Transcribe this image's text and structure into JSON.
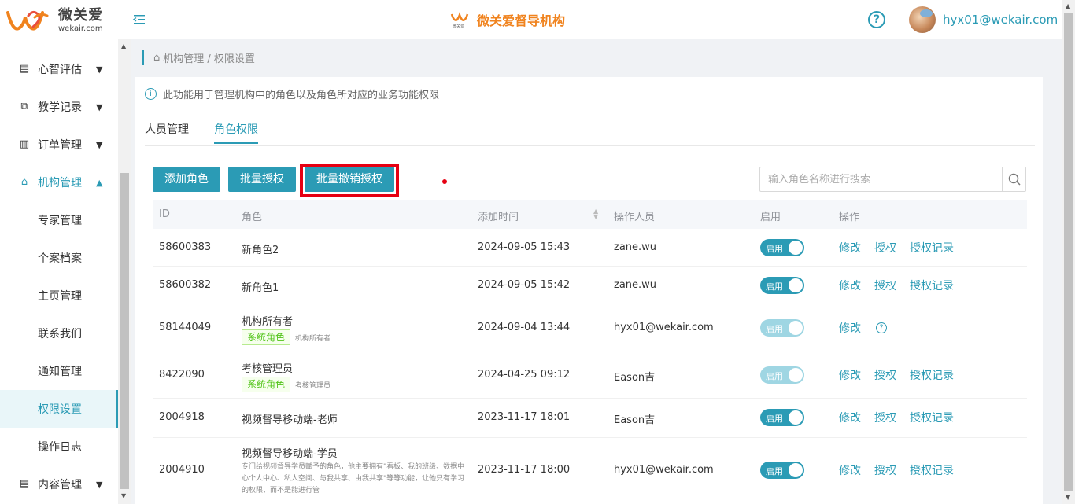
{
  "header": {
    "logo_cn": "微关爱",
    "logo_en": "wekair.com",
    "center_logo_text": "微关爱",
    "title": "微关爱督导机构",
    "help": "?",
    "user_email": "hyx01@wekair.com"
  },
  "sidebar": {
    "items": [
      {
        "label": "心智评估",
        "icon": "report-icon"
      },
      {
        "label": "教学记录",
        "icon": "video-icon"
      },
      {
        "label": "订单管理",
        "icon": "order-icon"
      },
      {
        "label": "机构管理",
        "icon": "bank-icon"
      },
      {
        "label": "专家管理"
      },
      {
        "label": "个案档案"
      },
      {
        "label": "主页管理"
      },
      {
        "label": "联系我们"
      },
      {
        "label": "通知管理"
      },
      {
        "label": "权限设置"
      },
      {
        "label": "操作日志"
      },
      {
        "label": "内容管理",
        "icon": "content-icon"
      }
    ]
  },
  "breadcrumb": "机构管理 / 权限设置",
  "notice": "此功能用于管理机构中的角色以及角色所对应的业务功能权限",
  "tabs": [
    "人员管理",
    "角色权限"
  ],
  "active_tab": "角色权限",
  "toolbar": {
    "add_role": "添加角色",
    "batch_grant": "批量授权",
    "batch_revoke": "批量撤销授权"
  },
  "search": {
    "placeholder": "输入角色名称进行搜索",
    "value": ""
  },
  "table": {
    "columns": [
      "ID",
      "角色",
      "添加时间",
      "操作人员",
      "启用",
      "操作"
    ],
    "rows": [
      {
        "id": "58600383",
        "role": "新角色2",
        "time": "2024-09-05 15:43",
        "operator": "zane.wu",
        "enabled": "启用"
      },
      {
        "id": "58600382",
        "role": "新角色1",
        "time": "2024-09-05 15:42",
        "operator": "zane.wu",
        "enabled": "启用"
      },
      {
        "id": "58144049",
        "role": "机构所有者",
        "tag": "系统角色",
        "desc": "机构所有者",
        "time": "2024-09-04 13:44",
        "operator": "hyx01@wekair.com",
        "enabled": "启用"
      },
      {
        "id": "8422090",
        "role": "考核管理员",
        "tag": "系统角色",
        "desc": "考核管理员",
        "time": "2024-04-25 09:12",
        "operator": "Eason吉",
        "enabled": "启用"
      },
      {
        "id": "2004918",
        "role": "视频督导移动端-老师",
        "time": "2023-11-17 18:01",
        "operator": "Eason吉",
        "enabled": "启用"
      },
      {
        "id": "2004910",
        "role": "视频督导移动端-学员",
        "desc": "专门给视频督导学员赋予的角色，他主要拥有\"看板、我的班级、数据中心个人中心、私人空间、与我共享、由我共享\"等等功能，让他只有学习的权限，而不是能进行管",
        "time": "2023-11-17 18:00",
        "operator": "hyx01@wekair.com",
        "enabled": "启用"
      }
    ],
    "actions": {
      "edit": "修改",
      "grant": "授权",
      "record": "授权记录",
      "help": "?"
    }
  },
  "colors": {
    "accent": "#2b9bb5",
    "brand_orange": "#f0831e",
    "highlight_red": "#e60012"
  }
}
